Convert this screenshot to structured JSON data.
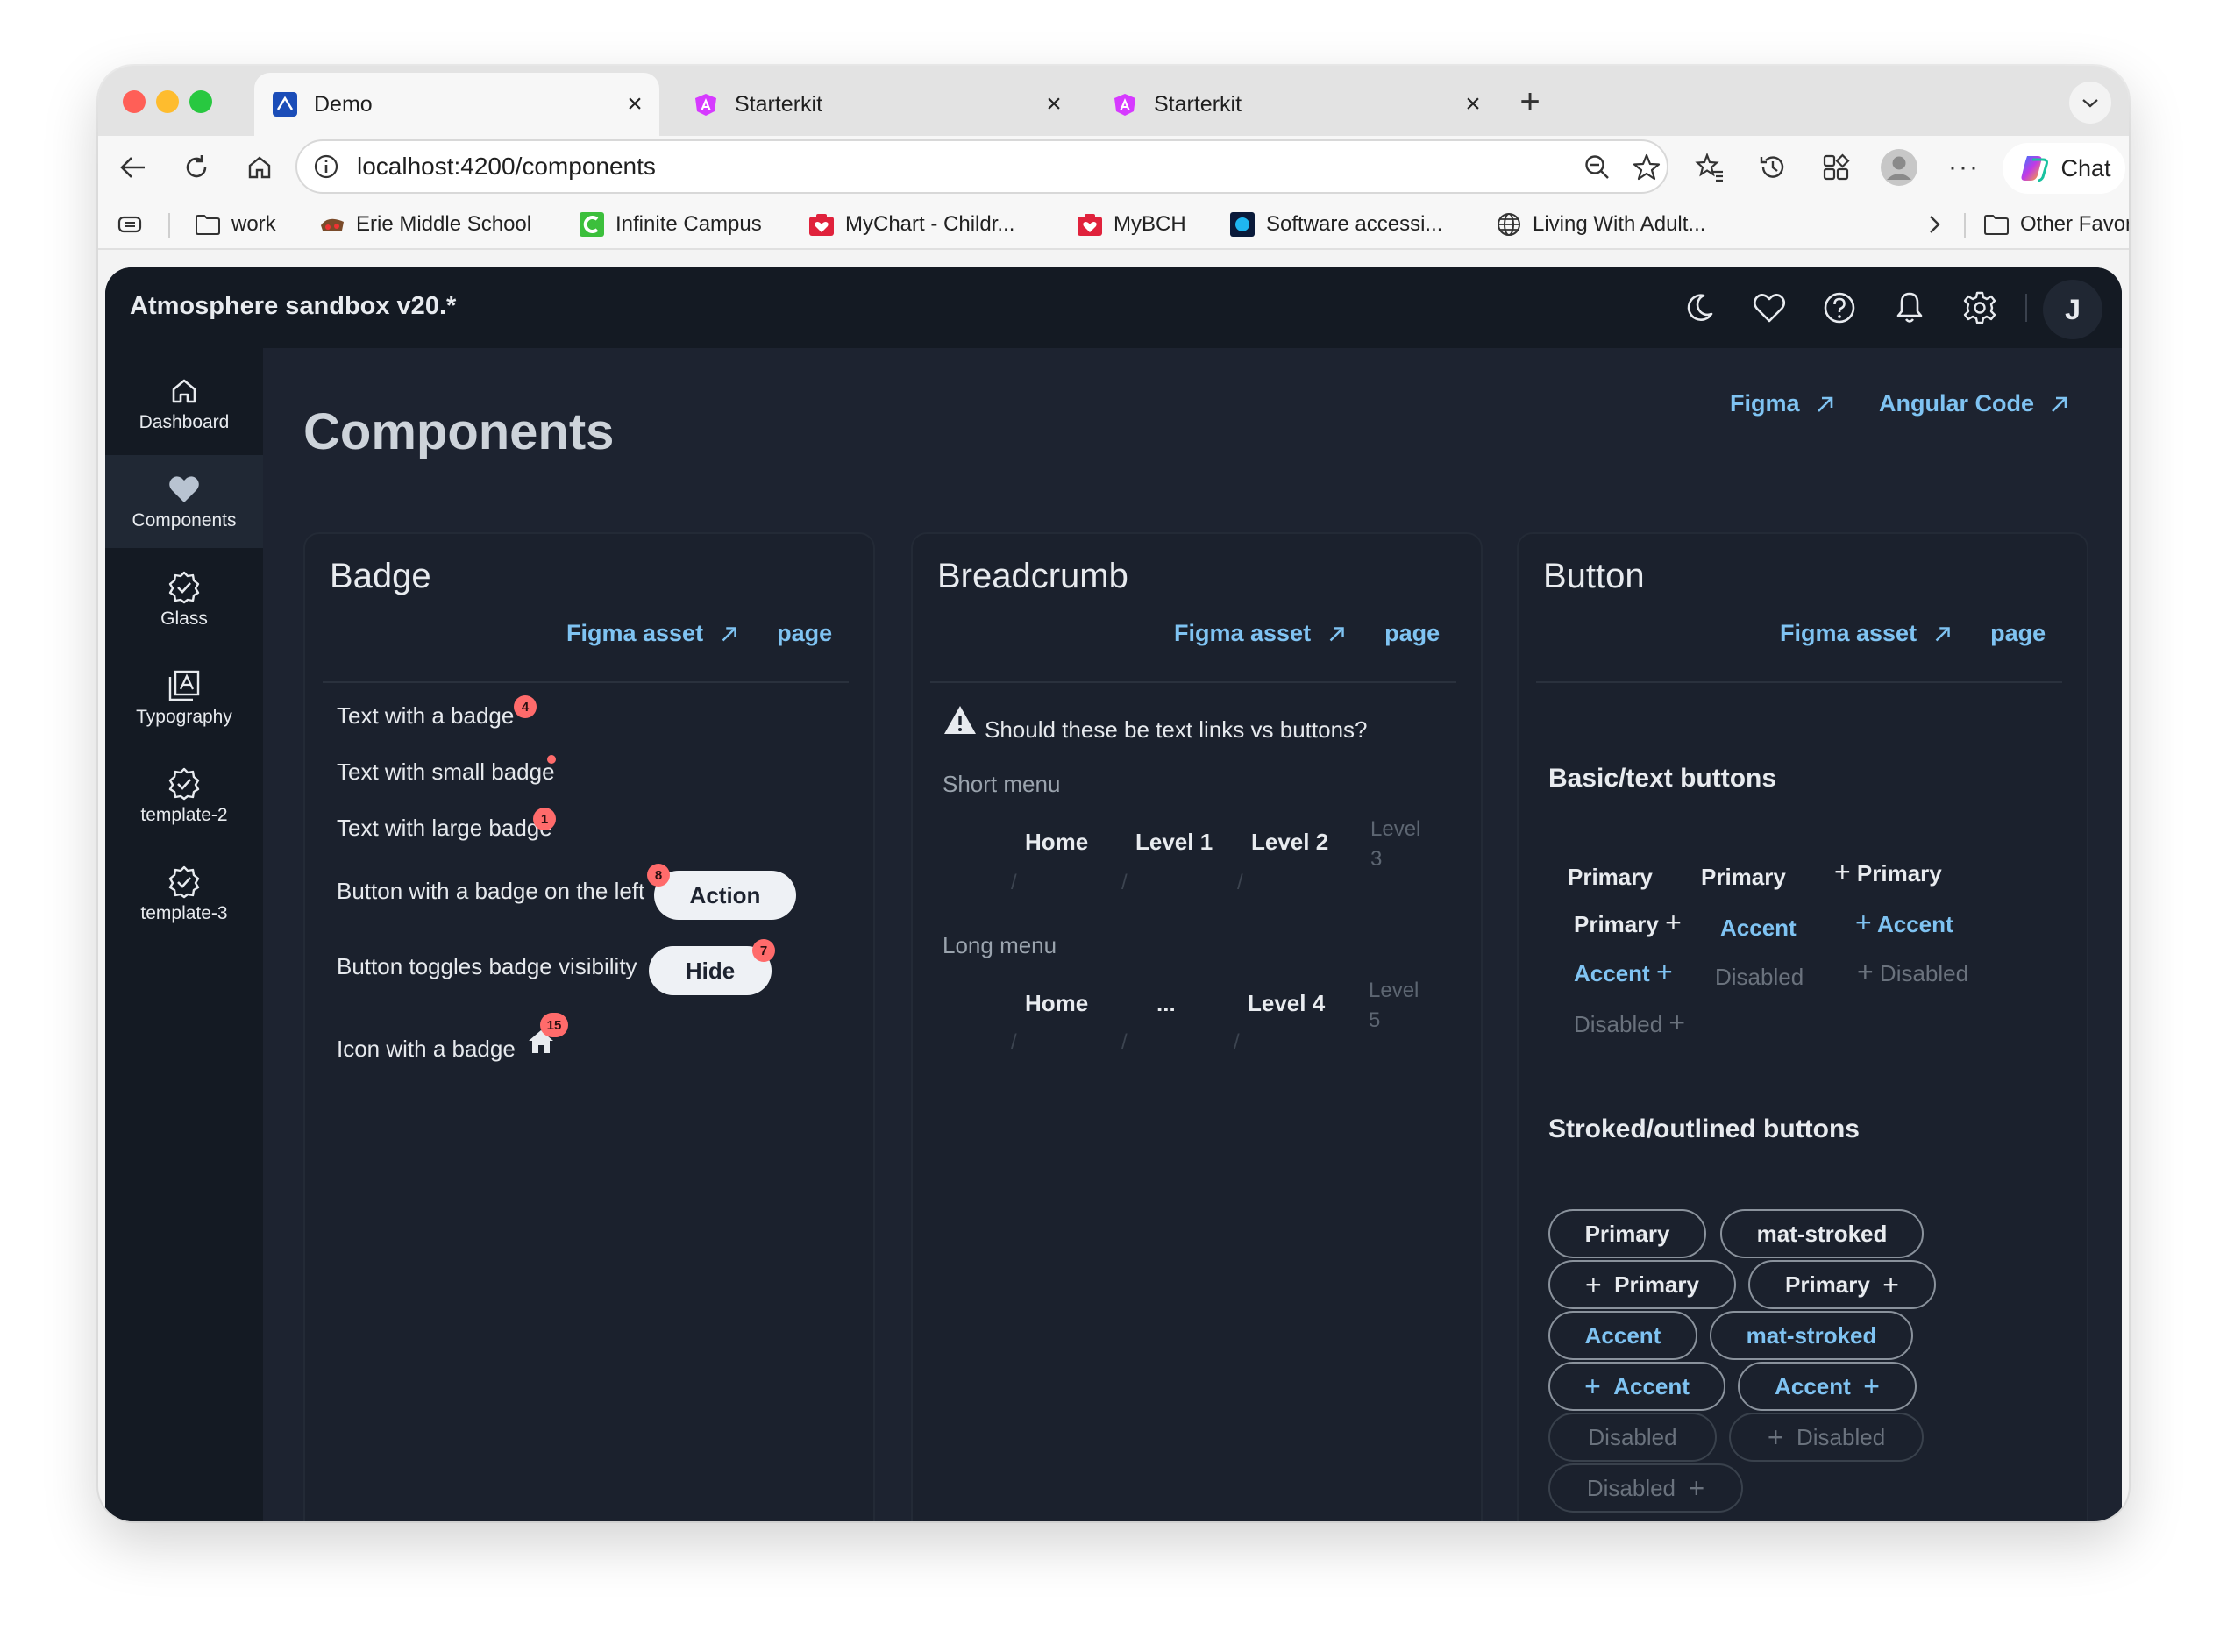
{
  "browser": {
    "tabs": [
      {
        "title": "Demo",
        "active": true
      },
      {
        "title": "Starterkit",
        "active": false
      },
      {
        "title": "Starterkit",
        "active": false
      }
    ],
    "url": "localhost:4200/components",
    "chat_label": "Chat",
    "bookmarks": [
      {
        "label": "work",
        "icon": "folder-icon"
      },
      {
        "label": "Erie Middle School",
        "icon": "school-icon"
      },
      {
        "label": "Infinite Campus",
        "icon": "campus-icon"
      },
      {
        "label": "MyChart - Childr...",
        "icon": "mychart-icon"
      },
      {
        "label": "MyBCH",
        "icon": "mybch-icon"
      },
      {
        "label": "Software accessi...",
        "icon": "software-icon"
      },
      {
        "label": "Living With Adult...",
        "icon": "globe-icon"
      }
    ],
    "other_favorites": "Other Favorites"
  },
  "app": {
    "title": "Atmosphere sandbox v20.*",
    "avatar_initial": "J",
    "nav": [
      {
        "label": "Dashboard",
        "icon": "home-icon",
        "selected": false
      },
      {
        "label": "Components",
        "icon": "heart-icon",
        "selected": true
      },
      {
        "label": "Glass",
        "icon": "verified-icon",
        "selected": false
      },
      {
        "label": "Typography",
        "icon": "typography-icon",
        "selected": false
      },
      {
        "label": "template-2",
        "icon": "verified-icon",
        "selected": false
      },
      {
        "label": "template-3",
        "icon": "verified-icon",
        "selected": false
      }
    ]
  },
  "page": {
    "title": "Components",
    "links": {
      "figma": "Figma",
      "angular": "Angular Code"
    }
  },
  "badge_card": {
    "title": "Badge",
    "figma_asset": "Figma asset",
    "page_link": "page",
    "rows": {
      "text_badge": "Text with a badge",
      "text_badge_count": "4",
      "small_badge": "Text with small badge",
      "large_badge": "Text with large badge",
      "large_badge_count": "1",
      "button_left": "Button with a badge on the left",
      "button_left_count": "8",
      "action_label": "Action",
      "toggle": "Button toggles badge visibility",
      "toggle_count": "7",
      "hide_label": "Hide",
      "icon_badge": "Icon with a badge",
      "icon_badge_count": "15"
    }
  },
  "breadcrumb_card": {
    "title": "Breadcrumb",
    "figma_asset": "Figma asset",
    "page_link": "page",
    "warning": "Should these be text links vs buttons?",
    "short_menu": {
      "label": "Short menu",
      "items": [
        "Home",
        "Level 1",
        "Level 2"
      ],
      "current_line1": "Level",
      "current_line2": "3"
    },
    "long_menu": {
      "label": "Long menu",
      "items": [
        "Home",
        "...",
        "Level 4"
      ],
      "current_line1": "Level",
      "current_line2": "5"
    },
    "separator": "/"
  },
  "button_card": {
    "title": "Button",
    "figma_asset": "Figma asset",
    "page_link": "page",
    "basic_heading": "Basic/text buttons",
    "basic": {
      "primary": "Primary",
      "accent": "Accent",
      "disabled": "Disabled"
    },
    "stroked_heading": "Stroked/outlined buttons",
    "stroked": {
      "primary": "Primary",
      "mat_stroked": "mat-stroked",
      "accent": "Accent",
      "disabled": "Disabled"
    }
  }
}
